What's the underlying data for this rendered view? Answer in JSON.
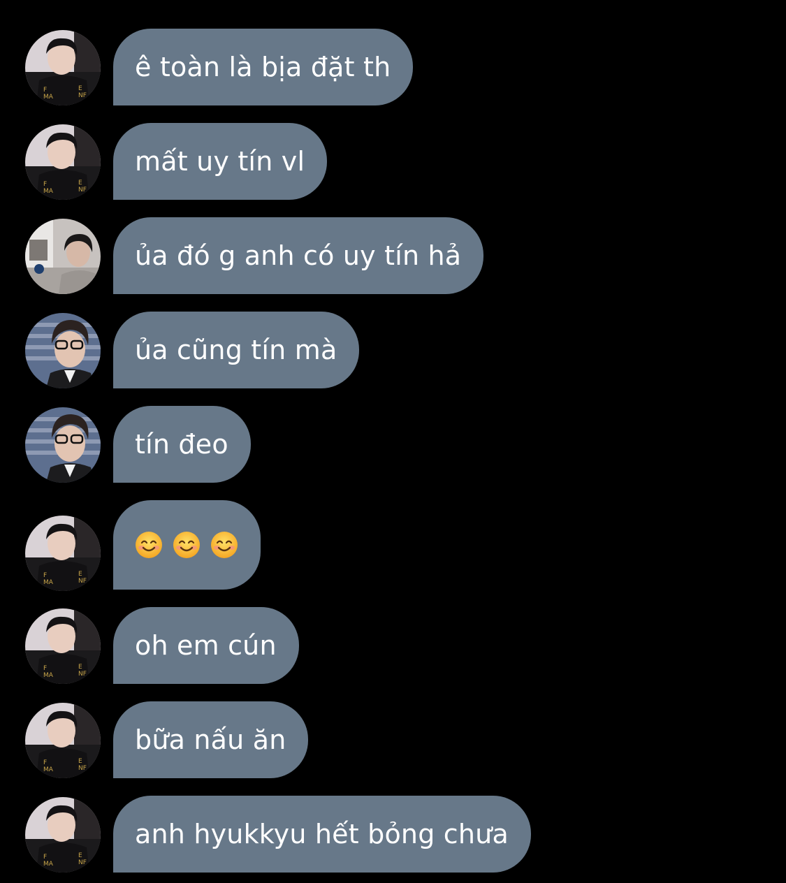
{
  "colors": {
    "background": "#000000",
    "bubble": "#677889",
    "text": "#ffffff"
  },
  "messages": [
    {
      "avatar": "avatar-a",
      "text": "ê toàn là bịa đặt th"
    },
    {
      "avatar": "avatar-a",
      "text": "mất uy tín vl"
    },
    {
      "avatar": "avatar-b",
      "text": "ủa đó g anh có uy tín hả"
    },
    {
      "avatar": "avatar-c",
      "text": "ủa cũng tín mà"
    },
    {
      "avatar": "avatar-c",
      "text": "tín đeo"
    },
    {
      "avatar": "avatar-a",
      "emoji": [
        "smiling-face-icon",
        "smiling-face-icon",
        "smiling-face-icon"
      ]
    },
    {
      "avatar": "avatar-a",
      "text": "oh em cún"
    },
    {
      "avatar": "avatar-a",
      "text": "bữa nấu ăn"
    },
    {
      "avatar": "avatar-a",
      "text": "anh hyukkyu hết bỏng chưa"
    }
  ]
}
